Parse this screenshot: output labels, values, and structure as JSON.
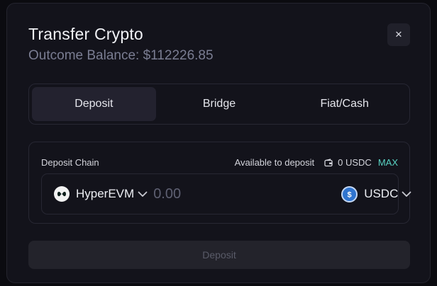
{
  "modal": {
    "title": "Transfer Crypto",
    "balance_text": "Outcome Balance: $112226.85",
    "close_icon": "close-icon"
  },
  "tabs": [
    {
      "label": "Deposit",
      "active": true
    },
    {
      "label": "Bridge",
      "active": false
    },
    {
      "label": "Fiat/Cash",
      "active": false
    }
  ],
  "deposit": {
    "chain_label": "Deposit Chain",
    "available_label": "Available to deposit",
    "wallet_icon": "wallet-icon",
    "available_amount": "0 USDC",
    "max_label": "MAX",
    "chain": {
      "name": "HyperEVM",
      "icon": "hyperevm-logo-icon"
    },
    "amount": {
      "value": "",
      "placeholder": "0.00"
    },
    "token": {
      "name": "USDC",
      "icon": "usdc-logo-icon"
    },
    "submit_label": "Deposit"
  },
  "colors": {
    "accent_max": "#59d3c3",
    "background": "#13131b",
    "active_tab": "#23222f",
    "usdc_blue": "#2f74cf"
  }
}
